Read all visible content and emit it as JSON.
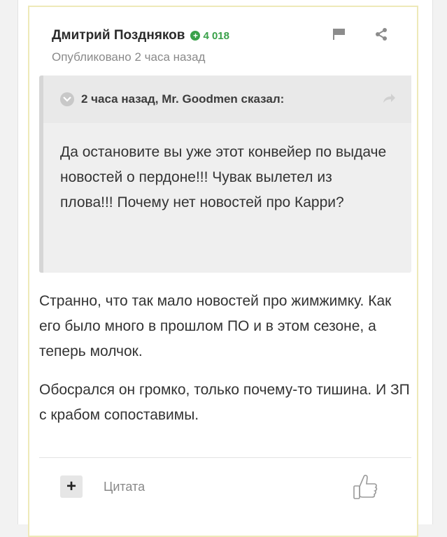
{
  "post": {
    "author": "Дмитрий Поздняков",
    "reputation": "4 018",
    "published": "Опубликовано 2 часа назад",
    "quote": {
      "header": "2 часа назад, Mr. Goodmen сказал:",
      "text": "Да остановите вы уже этот конвейер по выдаче новостей о пердоне!!! Чувак вылетел из плова!!! Почему нет новостей про Карри?"
    },
    "paragraphs": [
      "Странно, что так мало новостей про жимжимку. Как его было много в прошлом ПО и в этом сезоне, а теперь молчок.",
      "Обосрался он громко, только почему-то тишина. И ЗП с крабом сопоставимы."
    ],
    "footer": {
      "quote_label": "Цитата"
    }
  },
  "icons": [
    "flag-icon",
    "share-icon",
    "chevron-down-icon",
    "reply-arrow-icon",
    "plus-icon",
    "thumbs-up-icon"
  ],
  "colors": {
    "reputation": "#3aa14a",
    "post_border": "#eee9b8",
    "quote_bg": "#efefef"
  }
}
